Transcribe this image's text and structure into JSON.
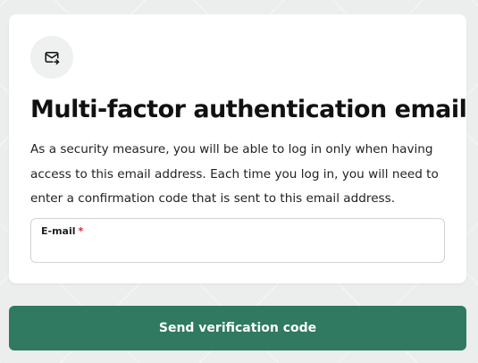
{
  "card": {
    "title": "Multi-factor authentication email",
    "description": "As a security measure, you will be able to log in only when having access to this email address. Each time you log in, you will need to enter a confirmation code that is sent to this email address.",
    "icon": "mail-forward-icon"
  },
  "email_field": {
    "label": "E-mail",
    "required_marker": "*",
    "value": "",
    "placeholder": ""
  },
  "actions": {
    "send_label": "Send verification code"
  },
  "colors": {
    "accent": "#2f7a60",
    "required": "#d9272e",
    "icon_bg": "#eef1ef"
  }
}
